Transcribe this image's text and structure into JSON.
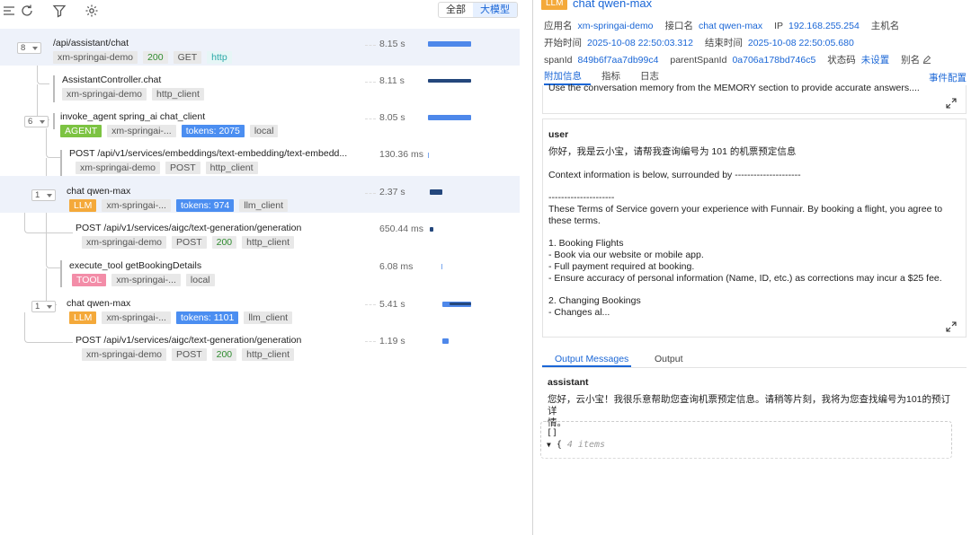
{
  "toolbar": {
    "view_all": "全部",
    "view_llm": "大模型"
  },
  "spans": [
    {
      "count": "8",
      "title": "/api/assistant/chat",
      "tags": [
        "xm-springai-demo",
        "200",
        "GET",
        "http"
      ],
      "duration": "8.15 s"
    },
    {
      "count": "",
      "title": "AssistantController.chat",
      "tags": [
        "xm-springai-demo",
        "http_client"
      ],
      "duration": "8.11 s"
    },
    {
      "count": "6",
      "title": "invoke_agent spring_ai chat_client",
      "tags": [
        "AGENT",
        "xm-springai-...",
        "tokens: 2075",
        "local"
      ],
      "duration": "8.05 s"
    },
    {
      "count": "",
      "title": "POST /api/v1/services/embeddings/text-embedding/text-embedd...",
      "tags": [
        "xm-springai-demo",
        "POST",
        "http_client"
      ],
      "duration": "130.36 ms"
    },
    {
      "count": "1",
      "title": "chat qwen-max",
      "tags": [
        "LLM",
        "xm-springai-...",
        "tokens: 974",
        "llm_client"
      ],
      "duration": "2.37 s"
    },
    {
      "count": "",
      "title": "POST /api/v1/services/aigc/text-generation/generation",
      "tags": [
        "xm-springai-demo",
        "POST",
        "200",
        "http_client"
      ],
      "duration": "650.44 ms"
    },
    {
      "count": "",
      "title": "execute_tool getBookingDetails",
      "tags": [
        "TOOL",
        "xm-springai-...",
        "local"
      ],
      "duration": "6.08 ms"
    },
    {
      "count": "1",
      "title": "chat qwen-max",
      "tags": [
        "LLM",
        "xm-springai-...",
        "tokens: 1101",
        "llm_client"
      ],
      "duration": "5.41 s"
    },
    {
      "count": "",
      "title": "POST /api/v1/services/aigc/text-generation/generation",
      "tags": [
        "xm-springai-demo",
        "POST",
        "200",
        "http_client"
      ],
      "duration": "1.19 s"
    }
  ],
  "detail": {
    "badge": "LLM",
    "title": "chat qwen-max",
    "meta": {
      "app_label": "应用名",
      "app_value": "xm-springai-demo",
      "iface_label": "接口名",
      "iface_value": "chat qwen-max",
      "ip_label": "IP",
      "ip_value": "192.168.255.254",
      "host_label": "主机名",
      "start_label": "开始时间",
      "start_value": "2025-10-08 22:50:03.312",
      "end_label": "结束时间",
      "end_value": "2025-10-08 22:50:05.680",
      "spanid_label": "spanId",
      "spanid_value": "849b6f7aa7db99c4",
      "parent_label": "parentSpanId",
      "parent_value": "0a706a178bd746c5",
      "status_label": "状态码",
      "status_value": "未设置",
      "alias_label": "别名"
    },
    "tabs": [
      "附加信息",
      "指标",
      "日志"
    ],
    "event_config": "事件配置",
    "clipped_line": "Use the conversation memory from the MEMORY section to provide accurate answers....",
    "user_role": "user",
    "user_message": "你好，我是云小宝，请帮我查询编号为 101 的机票预定信息\n\nContext information is below, surrounded by ---------------------\n\n---------------------\nThese Terms of Service govern your experience with Funnair. By booking a flight, you agree to\nthese terms.\n\n1. Booking Flights\n- Book via our website or mobile app.\n- Full payment required at booking.\n- Ensure accuracy of personal information (Name, ID, etc.) as corrections may incur a $25 fee.\n\n2. Changing Bookings\n- Changes al...",
    "output_tabs": [
      "Output Messages",
      "Output"
    ],
    "assistant_role": "assistant",
    "assistant_message": "您好，云小宝！我很乐意帮助您查询机票预定信息。请稍等片刻，我将为您查找编号为101的预订详\n情。",
    "json_root": "[]",
    "json_brace": "{",
    "json_count": "4 items"
  }
}
